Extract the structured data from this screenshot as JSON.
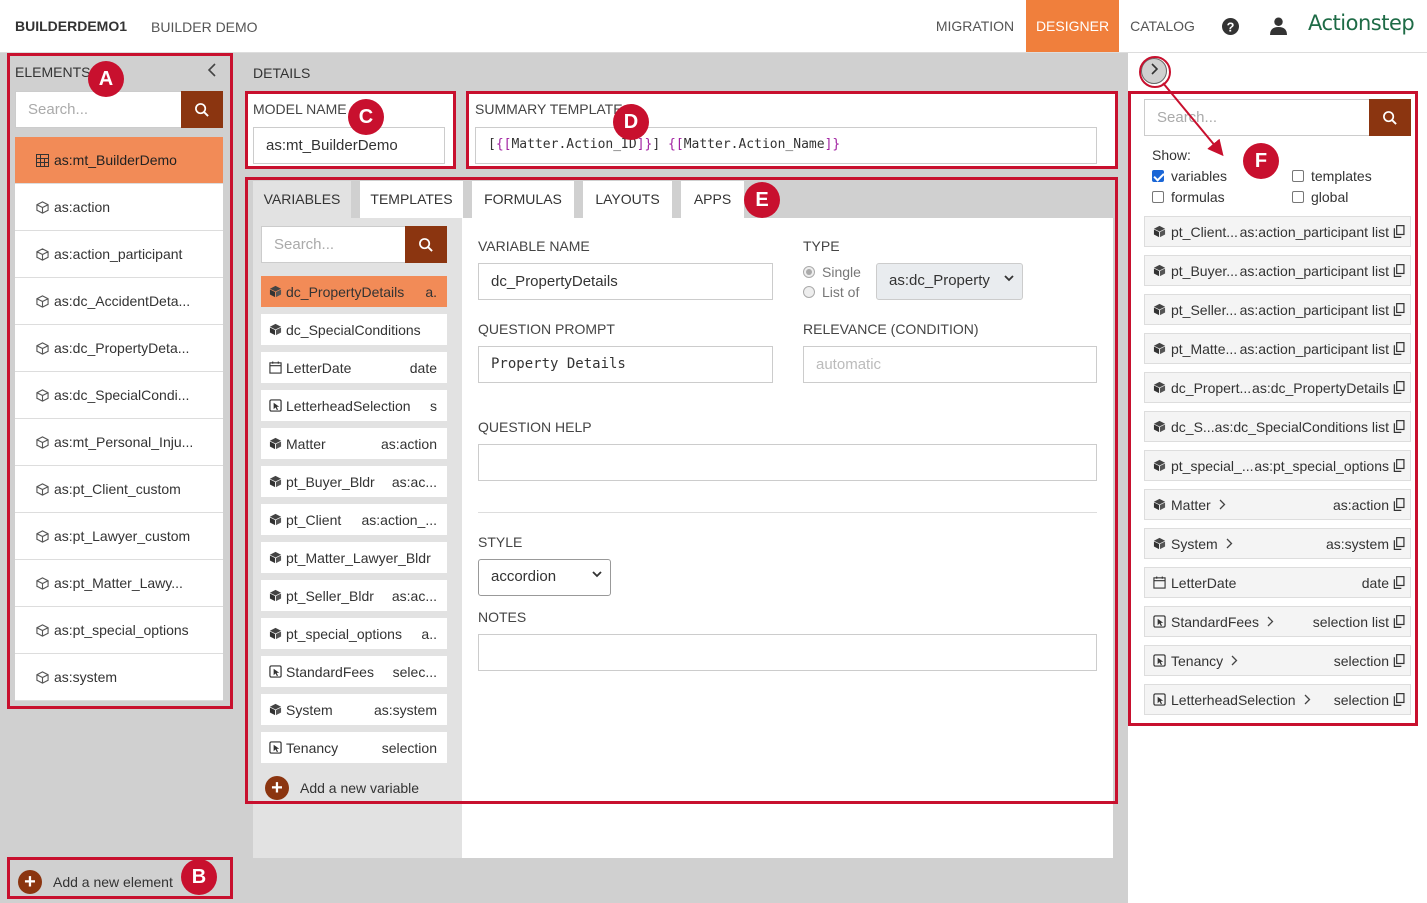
{
  "topbar": {
    "brand": "BUILDERDEMO1",
    "subtitle": "BUILDER DEMO",
    "nav": [
      "MIGRATION",
      "DESIGNER",
      "CATALOG"
    ],
    "active_nav": "DESIGNER",
    "help_icon": "question-circle-icon",
    "user_icon": "user-icon",
    "logo": "Actionstep",
    "accent_color": "#f07f3c",
    "logo_color": "#1e6b46"
  },
  "elements_panel": {
    "heading": "ELEMENTS",
    "search_placeholder": "Search...",
    "items": [
      {
        "label": "as:mt_BuilderDemo",
        "icon": "grid-icon",
        "active": true
      },
      {
        "label": "as:action",
        "icon": "cube-outline-icon"
      },
      {
        "label": "as:action_participant",
        "icon": "cube-outline-icon"
      },
      {
        "label": "as:dc_AccidentDeta...",
        "icon": "cube-outline-icon"
      },
      {
        "label": "as:dc_PropertyDeta...",
        "icon": "cube-outline-icon"
      },
      {
        "label": "as:dc_SpecialCondi...",
        "icon": "cube-outline-icon"
      },
      {
        "label": "as:mt_Personal_Inju...",
        "icon": "cube-outline-icon"
      },
      {
        "label": "as:pt_Client_custom",
        "icon": "cube-outline-icon"
      },
      {
        "label": "as:pt_Lawyer_custom",
        "icon": "cube-outline-icon"
      },
      {
        "label": "as:pt_Matter_Lawy...",
        "icon": "cube-outline-icon"
      },
      {
        "label": "as:pt_special_options",
        "icon": "cube-outline-icon"
      },
      {
        "label": "as:system",
        "icon": "cube-outline-icon"
      }
    ],
    "add_label": "Add a new element"
  },
  "details": {
    "heading": "DETAILS",
    "model_name_label": "MODEL NAME",
    "model_name_value": "as:mt_BuilderDemo",
    "summary_template_label": "SUMMARY TEMPLATE",
    "summary_template_parts": [
      "[",
      "{[",
      "Matter.Action_ID",
      "]}",
      "] ",
      "{[",
      "Matter.Action_Name",
      "]}"
    ],
    "tabs": [
      "VARIABLES",
      "TEMPLATES",
      "FORMULAS",
      "LAYOUTS",
      "APPS"
    ],
    "active_tab": "VARIABLES"
  },
  "variables": {
    "search_placeholder": "Search...",
    "items": [
      {
        "name": "dc_PropertyDetails",
        "type": "a.",
        "icon": "cube-icon",
        "active": true
      },
      {
        "name": "dc_SpecialConditions",
        "type": "",
        "icon": "cube-icon"
      },
      {
        "name": "LetterDate",
        "type": "date",
        "icon": "calendar-icon"
      },
      {
        "name": "LetterheadSelection",
        "type": "s",
        "icon": "selection-icon"
      },
      {
        "name": "Matter",
        "type": "as:action",
        "icon": "cube-icon"
      },
      {
        "name": "pt_Buyer_Bldr",
        "type": "as:ac...",
        "icon": "cube-icon"
      },
      {
        "name": "pt_Client",
        "type": "as:action_...",
        "icon": "cube-icon"
      },
      {
        "name": "pt_Matter_Lawyer_Bldr",
        "type": "",
        "icon": "cube-icon"
      },
      {
        "name": "pt_Seller_Bldr",
        "type": "as:ac...",
        "icon": "cube-icon"
      },
      {
        "name": "pt_special_options",
        "type": "a..",
        "icon": "cube-icon"
      },
      {
        "name": "StandardFees",
        "type": "selec...",
        "icon": "selection-icon"
      },
      {
        "name": "System",
        "type": "as:system",
        "icon": "cube-icon"
      },
      {
        "name": "Tenancy",
        "type": "selection",
        "icon": "selection-icon"
      }
    ],
    "add_label": "Add a new variable"
  },
  "form": {
    "variable_name_label": "VARIABLE NAME",
    "variable_name_value": "dc_PropertyDetails",
    "type_label": "TYPE",
    "type_options": [
      "Single",
      "List of"
    ],
    "type_selected": "Single",
    "type_select_value": "as:dc_Property",
    "question_prompt_label": "QUESTION PROMPT",
    "question_prompt_value": "Property Details",
    "relevance_label": "RELEVANCE (CONDITION)",
    "relevance_placeholder": "automatic",
    "question_help_label": "QUESTION HELP",
    "style_label": "STYLE",
    "style_value": "accordion",
    "notes_label": "NOTES"
  },
  "catalog_panel": {
    "search_placeholder": "Search...",
    "show_label": "Show:",
    "filters": [
      {
        "label": "variables",
        "checked": true
      },
      {
        "label": "templates",
        "checked": false
      },
      {
        "label": "formulas",
        "checked": false
      },
      {
        "label": "global",
        "checked": false
      }
    ],
    "items": [
      {
        "name": "pt_Client...",
        "type": "as:action_participant list",
        "icon": "cube-icon",
        "chevron": false
      },
      {
        "name": "pt_Buyer...",
        "type": "as:action_participant list",
        "icon": "cube-icon",
        "chevron": false
      },
      {
        "name": "pt_Seller...",
        "type": "as:action_participant list",
        "icon": "cube-icon",
        "chevron": false
      },
      {
        "name": "pt_Matte...",
        "type": "as:action_participant list",
        "icon": "cube-icon",
        "chevron": false
      },
      {
        "name": "dc_Propert...",
        "type": "as:dc_PropertyDetails",
        "icon": "cube-icon",
        "chevron": false
      },
      {
        "name": "dc_S...",
        "type": "as:dc_SpecialConditions list",
        "icon": "cube-icon",
        "chevron": false
      },
      {
        "name": "pt_special_...",
        "type": "as:pt_special_options",
        "icon": "cube-icon",
        "chevron": false
      },
      {
        "name": "Matter",
        "type": "as:action",
        "icon": "cube-icon",
        "chevron": true
      },
      {
        "name": "System",
        "type": "as:system",
        "icon": "cube-icon",
        "chevron": true
      },
      {
        "name": "LetterDate",
        "type": "date",
        "icon": "calendar-icon",
        "chevron": false
      },
      {
        "name": "StandardFees",
        "type": "selection list",
        "icon": "selection-icon",
        "chevron": true
      },
      {
        "name": "Tenancy",
        "type": "selection",
        "icon": "selection-icon",
        "chevron": true
      },
      {
        "name": "LetterheadSelection",
        "type": "selection",
        "icon": "selection-icon",
        "chevron": true
      }
    ]
  },
  "annotations": [
    "A",
    "B",
    "C",
    "D",
    "E",
    "F"
  ],
  "annotation_color": "#c8102e"
}
